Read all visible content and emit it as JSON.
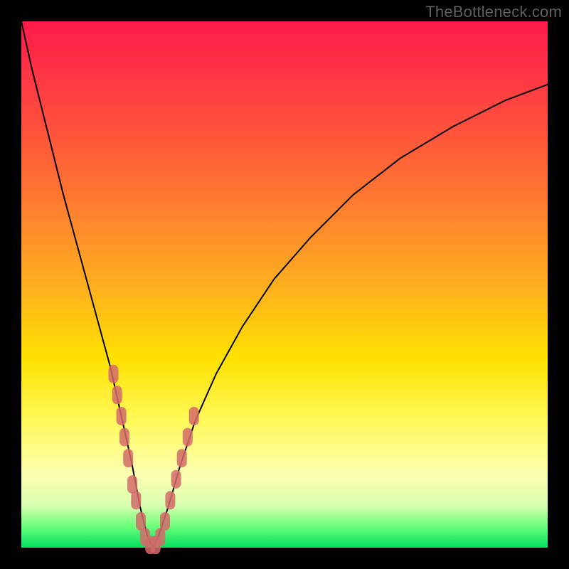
{
  "watermark": "TheBottleneck.com",
  "chart_data": {
    "type": "line",
    "title": "",
    "xlabel": "",
    "ylabel": "",
    "xlim": [
      0,
      100
    ],
    "ylim": [
      0,
      100
    ],
    "grid": false,
    "legend": false,
    "series": [
      {
        "name": "bottleneck-curve",
        "color": "#000000",
        "x": [
          0,
          2,
          5,
          8,
          11,
          14,
          17,
          19,
          21,
          22.5,
          24,
          25,
          26,
          28,
          30,
          33,
          37,
          42,
          48,
          55,
          63,
          72,
          82,
          92,
          100
        ],
        "y": [
          100,
          91,
          79,
          67,
          56,
          45,
          34,
          25,
          16,
          8,
          2,
          0,
          2,
          8,
          15,
          24,
          33,
          42,
          51,
          59,
          67,
          74,
          80,
          85,
          88
        ]
      },
      {
        "name": "highlight-dots",
        "color": "#d46a6a",
        "type": "scatter",
        "points": [
          {
            "x": 17.5,
            "y": 33
          },
          {
            "x": 18.2,
            "y": 29
          },
          {
            "x": 19.0,
            "y": 25
          },
          {
            "x": 19.6,
            "y": 21
          },
          {
            "x": 20.3,
            "y": 17
          },
          {
            "x": 21.1,
            "y": 12
          },
          {
            "x": 21.8,
            "y": 9
          },
          {
            "x": 22.7,
            "y": 5
          },
          {
            "x": 23.5,
            "y": 2
          },
          {
            "x": 24.5,
            "y": 0.5
          },
          {
            "x": 25.5,
            "y": 0.5
          },
          {
            "x": 26.4,
            "y": 2
          },
          {
            "x": 27.3,
            "y": 5
          },
          {
            "x": 28.3,
            "y": 9
          },
          {
            "x": 29.4,
            "y": 13
          },
          {
            "x": 30.5,
            "y": 17
          },
          {
            "x": 31.6,
            "y": 21
          },
          {
            "x": 32.8,
            "y": 25
          }
        ]
      }
    ]
  }
}
